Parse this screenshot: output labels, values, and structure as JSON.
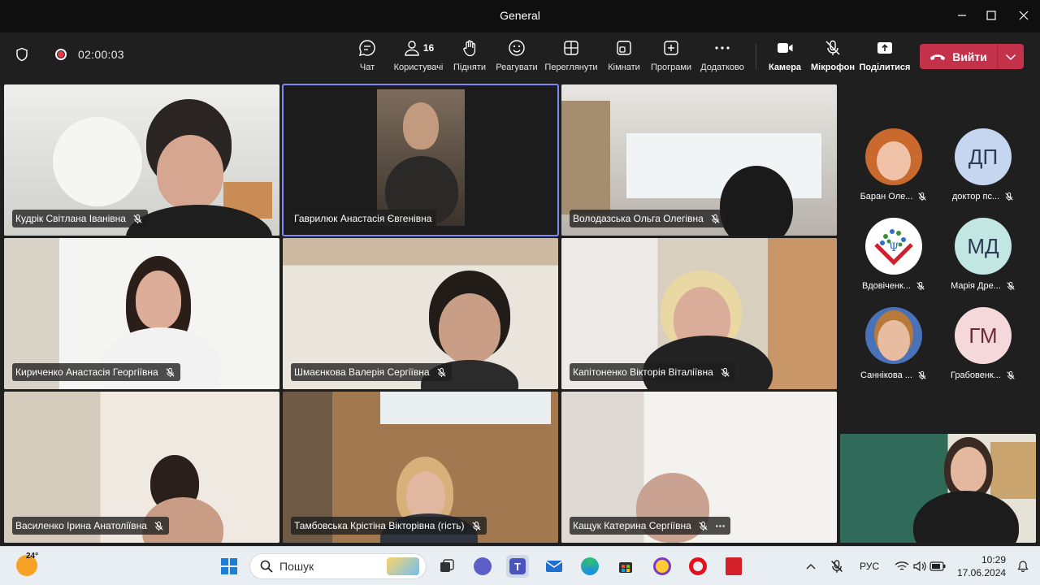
{
  "window": {
    "title": "General"
  },
  "toolbar": {
    "timer": "02:00:03",
    "buttons": {
      "chat": "Чат",
      "people": "Користувачі",
      "people_count": "16",
      "raise": "Підняти",
      "react": "Реагувати",
      "view": "Переглянути",
      "rooms": "Кімнати",
      "apps": "Програми",
      "more": "Додатково",
      "camera": "Камера",
      "mic": "Мікрофон",
      "share": "Поділитися"
    },
    "leave_label": "Вийти"
  },
  "participants": [
    {
      "name": "Кудрік Світлана Іванівна"
    },
    {
      "name": "Гаврилюк Анастасія Євгенівна"
    },
    {
      "name": "Володазська Ольга Олегівна"
    },
    {
      "name": "Кириченко Анастасія Георгіївна"
    },
    {
      "name": "Шмаєнкова Валерія Сергіївна"
    },
    {
      "name": "Капітоненко Вікторія Віталіївна"
    },
    {
      "name": "Василенко Ірина Анатоліївна"
    },
    {
      "name": "Тамбовська Крістіна Вікторівна (гість)"
    },
    {
      "name": "Кащук Катерина Сергіївна"
    }
  ],
  "sidebar_participants": [
    {
      "name": "Баран Оле...",
      "initials": "",
      "avatar_color": "#c9692e"
    },
    {
      "name": "доктор пс...",
      "initials": "ДП",
      "avatar_color": "#c7d6f0"
    },
    {
      "name": "Вдовіченк...",
      "initials": "",
      "avatar_color": "#ffffff"
    },
    {
      "name": "Марія Дре...",
      "initials": "МД",
      "avatar_color": "#c2e6e2"
    },
    {
      "name": "Саннікова ...",
      "initials": "",
      "avatar_color": "#4a72b8"
    },
    {
      "name": "Грабовенк...",
      "initials": "ГМ",
      "avatar_color": "#f5d9da"
    }
  ],
  "taskbar": {
    "weather_temp": "24°",
    "search_placeholder": "Пошук",
    "language": "РУС",
    "time": "10:29",
    "date": "17.06.2024"
  },
  "colors": {
    "leave": "#c4314b",
    "speaking_outline": "#7f85f5",
    "background": "#1f1f1f"
  }
}
